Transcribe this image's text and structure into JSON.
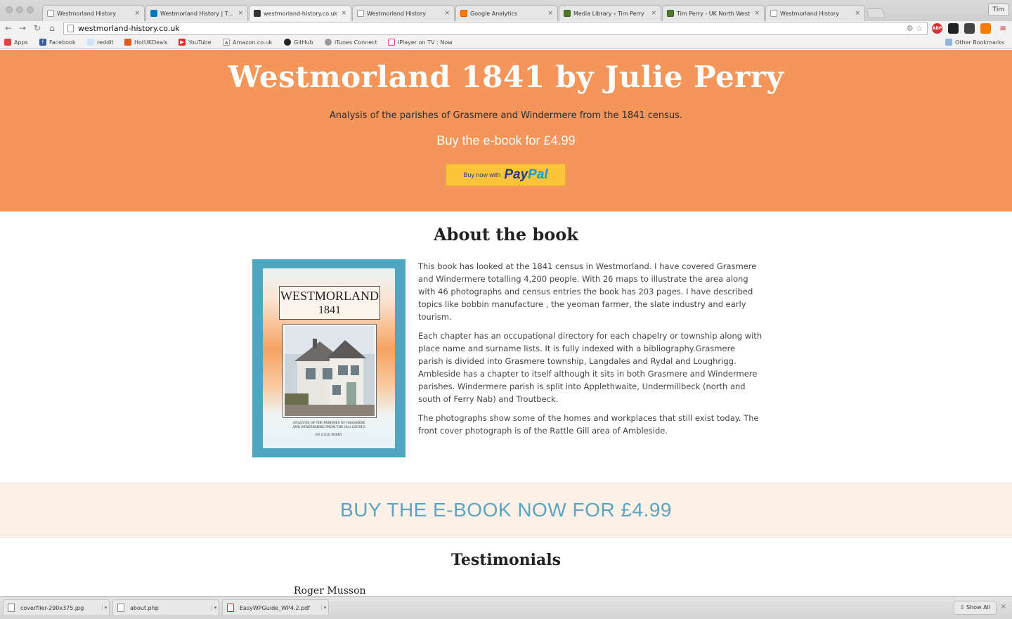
{
  "browser": {
    "tabs": [
      {
        "title": "Westmorland History",
        "icon": "page-icon"
      },
      {
        "title": "Westmorland History | Trello",
        "icon": "trello-icon"
      },
      {
        "title": "westmorland-history.co.uk",
        "icon": "wordpress-icon"
      },
      {
        "title": "Westmorland History",
        "icon": "page-icon"
      },
      {
        "title": "Google Analytics",
        "icon": "analytics-icon"
      },
      {
        "title": "Media Library ‹ Tim Perry",
        "icon": "media-icon"
      },
      {
        "title": "Tim Perry - UK North West",
        "icon": "media-icon"
      },
      {
        "title": "Westmorland History",
        "icon": "page-icon"
      }
    ],
    "tab_close": "×",
    "profile": "Tim",
    "url": "westmorland-history.co.uk",
    "extensions": [
      "ABP",
      "",
      "",
      ""
    ],
    "bookmarks": [
      {
        "label": "Apps"
      },
      {
        "label": "Facebook"
      },
      {
        "label": "reddit"
      },
      {
        "label": "HotUKDeals"
      },
      {
        "label": "YouTube"
      },
      {
        "label": "Amazon.co.uk"
      },
      {
        "label": "GitHub"
      },
      {
        "label": "iTunes Connect"
      },
      {
        "label": "iPlayer on TV : Now"
      }
    ],
    "other_bookmarks": "Other Bookmarks"
  },
  "hero": {
    "title": "Westmorland 1841 by Julie Perry",
    "subtitle": "Analysis of the parishes of Grasmere and Windermere from the 1841 census.",
    "price_line": "Buy the e-book for £4.99",
    "paypal_prefix": "Buy now with",
    "paypal_pay": "Pay",
    "paypal_pal": "Pal"
  },
  "about": {
    "heading": "About the book",
    "cover_title_1": "WESTMORLAND",
    "cover_title_2": "1841",
    "cover_caption_1": "ANALYSIS OF THE PARISHES OF GRASMERE",
    "cover_caption_2": "AND WINDERMERE FROM THE 1841 CENSUS",
    "cover_author": "BY JULIE PERRY",
    "paragraphs": [
      "This book has looked at the 1841 census in Westmorland. I have covered Grasmere and Windermere totalling 4,200 people. With 26 maps to illustrate the area along with 46 photographs and census entries the book has 203 pages. I have described topics like bobbin manufacture , the yeoman farmer, the slate industry and early tourism.",
      "Each chapter has an occupational directory for each chapelry or township along with place name and surname lists. It is fully indexed with a bibliography.Grasmere parish is divided into Grasmere township, Langdales and Rydal and Loughrigg. Ambleside has a chapter to itself  although it sits in both Grasmere and Windermere parishes. Windermere parish is split into Applethwaite, Undermillbeck (north and south of Ferry Nab) and Troutbeck.",
      "The photographs show some of the homes and workplaces that still exist today. The front cover photograph is of the Rattle Gill area of Ambleside."
    ]
  },
  "cta": {
    "label": "BUY THE E-BOOK NOW FOR £4.99"
  },
  "testimonials": {
    "heading": "Testimonials",
    "first_name": "Roger Musson"
  },
  "downloads": {
    "items": [
      {
        "name": "coverflier-290x375.jpg",
        "icon": "image-file-icon"
      },
      {
        "name": "about.php",
        "icon": "php-file-icon"
      },
      {
        "name": "EasyWPGuide_WP4.2.pdf",
        "icon": "pdf-file-icon"
      }
    ],
    "show_all": "Show All",
    "close": "×"
  },
  "colors": {
    "hero_bg": "#f4965a",
    "cta_bg": "#fdf0e7",
    "cta_text": "#5ca5c0",
    "paypal_button": "#fcc43b"
  }
}
